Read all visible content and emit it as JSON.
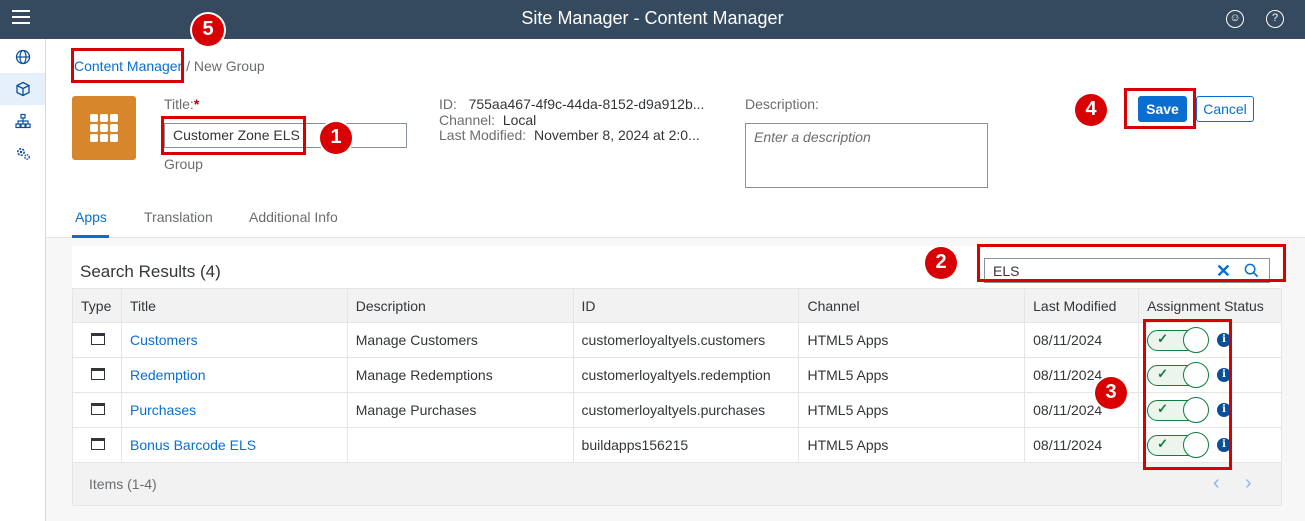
{
  "shell": {
    "title": "Site Manager - Content Manager",
    "user_icon": "user-icon",
    "help_icon": "help-icon",
    "help_glyph": "?",
    "user_glyph": "☺"
  },
  "sidenav": {
    "items": [
      {
        "name": "globe-icon"
      },
      {
        "name": "cube-icon",
        "active": true
      },
      {
        "name": "hierarchy-icon"
      },
      {
        "name": "gear-icon"
      }
    ]
  },
  "breadcrumb": {
    "link": "Content Manager",
    "current": "/ New Group"
  },
  "group": {
    "title_label": "Title:",
    "required_mark": "*",
    "title_value": "Customer Zone ELS",
    "type_label": "Group",
    "id_label": "ID:",
    "id_value": "755aa467-4f9c-44da-8152-d9a912b...",
    "channel_label": "Channel:",
    "channel_value": "Local",
    "modified_label": "Last Modified:",
    "modified_value": "November 8, 2024 at 2:0...",
    "description_label": "Description:",
    "description_placeholder": "Enter a description"
  },
  "actions": {
    "save": "Save",
    "cancel": "Cancel"
  },
  "tabs": [
    {
      "label": "Apps",
      "active": true
    },
    {
      "label": "Translation"
    },
    {
      "label": "Additional Info"
    }
  ],
  "results": {
    "title": "Search Results (4)",
    "search_value": "ELS",
    "columns": [
      "Type",
      "Title",
      "Description",
      "ID",
      "Channel",
      "Last Modified",
      "Assignment Status"
    ],
    "rows": [
      {
        "title": "Customers",
        "description": "Manage Customers",
        "id": "customerloyaltyels.customers",
        "channel": "HTML5 Apps",
        "modified": "08/11/2024",
        "assigned": true
      },
      {
        "title": "Redemption",
        "description": "Manage Redemptions",
        "id": "customerloyaltyels.redemption",
        "channel": "HTML5 Apps",
        "modified": "08/11/2024",
        "assigned": true
      },
      {
        "title": "Purchases",
        "description": "Manage Purchases",
        "id": "customerloyaltyels.purchases",
        "channel": "HTML5 Apps",
        "modified": "08/11/2024",
        "assigned": true
      },
      {
        "title": "Bonus Barcode ELS",
        "description": "",
        "id": "buildapps156215",
        "channel": "HTML5 Apps",
        "modified": "08/11/2024",
        "assigned": true
      }
    ],
    "footer": "Items (1-4)",
    "toggle_check": "✓",
    "info_glyph": "i"
  },
  "annotations": [
    "1",
    "2",
    "3",
    "4",
    "5"
  ],
  "colors": {
    "shell": "#354a5f",
    "accent": "#0a6ed1",
    "tile": "#d7862c",
    "annotation": "#d80000",
    "positive": "#107e3e"
  }
}
